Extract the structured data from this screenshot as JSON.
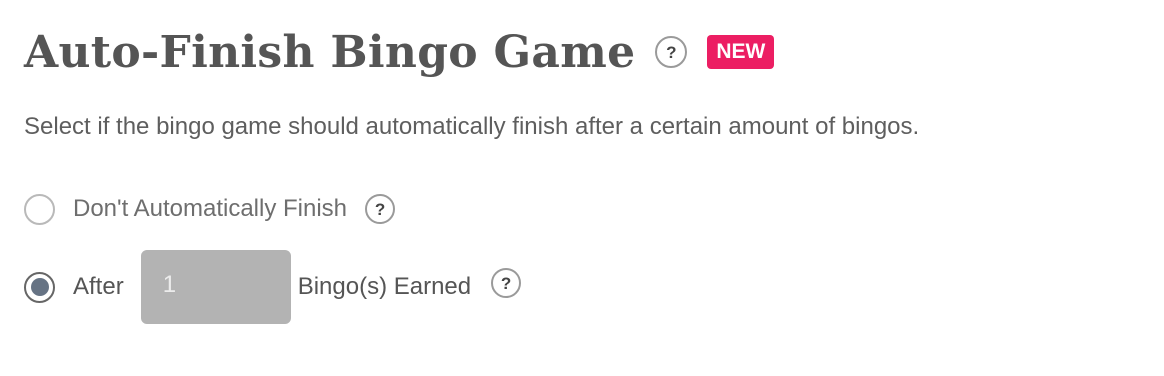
{
  "header": {
    "title": "Auto-Finish Bingo Game",
    "help_icon": "?",
    "badge": "NEW",
    "badge_color": "#ec1e63"
  },
  "description": "Select if the bingo game should automatically finish after a certain amount of bingos.",
  "options": [
    {
      "label": "Don't Automatically Finish",
      "selected": false,
      "help_icon": "?"
    },
    {
      "label": "After",
      "selected": true,
      "input_value": "1",
      "suffix": "Bingo(s) Earned",
      "help_icon": "?"
    }
  ],
  "colors": {
    "text": "#555555",
    "radio_selected_fill": "#667384",
    "input_background": "#b3b3b3"
  },
  "icons": {
    "help": "question-mark-circle-icon"
  }
}
